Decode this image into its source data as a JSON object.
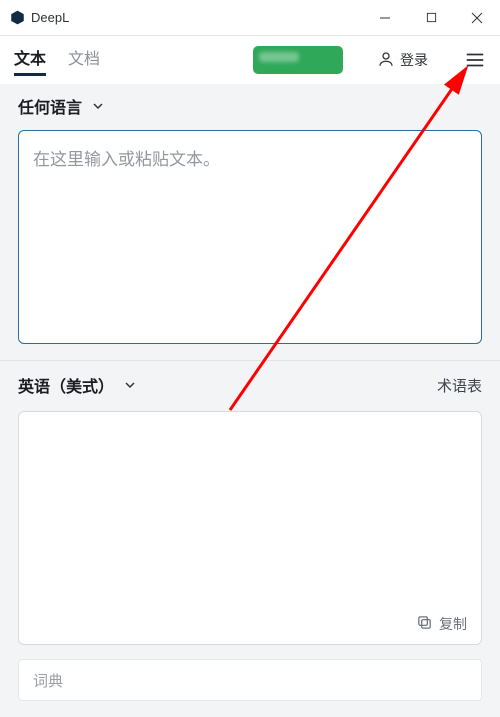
{
  "window": {
    "title": "DeepL"
  },
  "nav": {
    "tabs": {
      "text": "文本",
      "document": "文档"
    },
    "login_label": "登录"
  },
  "source": {
    "language_label": "任何语言",
    "placeholder": "在这里输入或粘贴文本。"
  },
  "target": {
    "language_label": "英语（美式）",
    "glossary_label": "术语表",
    "copy_label": "复制"
  },
  "dictionary": {
    "placeholder": "词典"
  }
}
